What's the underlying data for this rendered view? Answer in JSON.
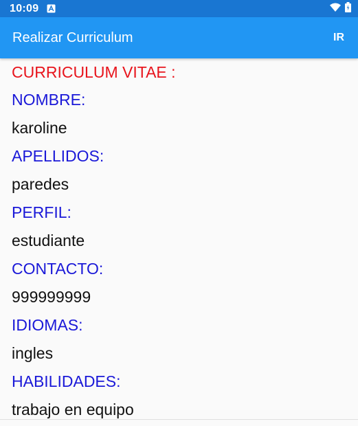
{
  "status_bar": {
    "time": "10:09",
    "notification_icon": "a-notification-icon",
    "wifi_icon": "wifi-icon",
    "battery_icon": "battery-icon",
    "background_color": "#1976d2"
  },
  "app_bar": {
    "title": "Realizar Curriculum",
    "action_label": "IR",
    "background_color": "#2196f3"
  },
  "cv": {
    "heading": "CURRICULUM VITAE :",
    "heading_color": "#e8141c",
    "label_color": "#1a18d8",
    "fields": [
      {
        "label": "NOMBRE:",
        "value": "karoline"
      },
      {
        "label": "APELLIDOS:",
        "value": "paredes"
      },
      {
        "label": "PERFIL:",
        "value": "estudiante"
      },
      {
        "label": "CONTACTO:",
        "value": "999999999"
      },
      {
        "label": "IDIOMAS:",
        "value": "ingles"
      },
      {
        "label": "HABILIDADES:",
        "value": "trabajo en equipo"
      }
    ]
  }
}
